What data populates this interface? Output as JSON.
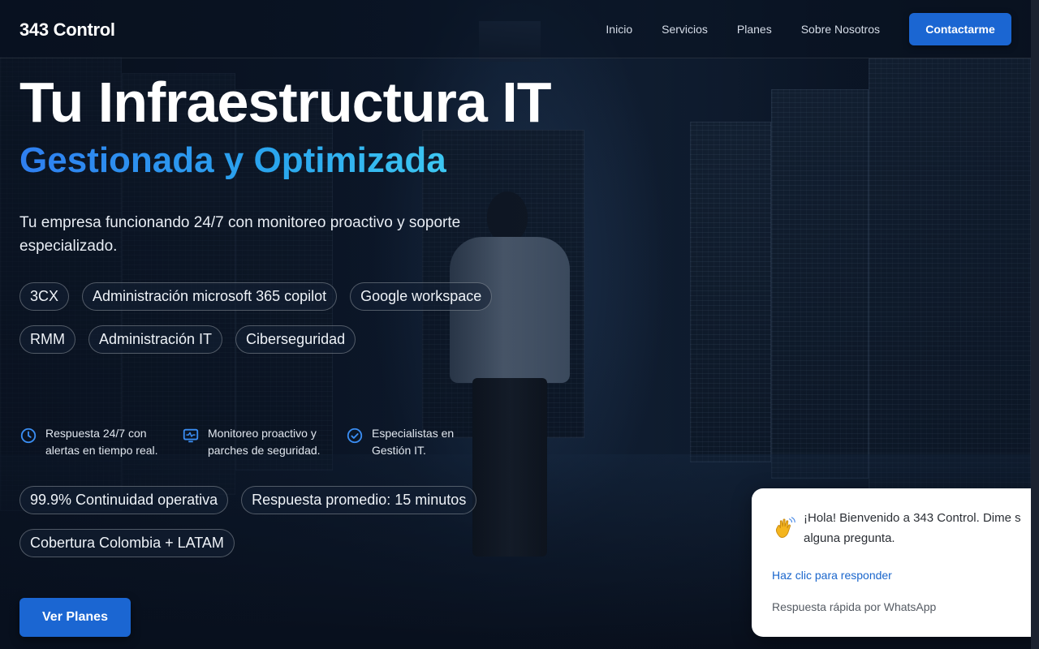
{
  "header": {
    "logo": "343 Control",
    "nav": [
      "Inicio",
      "Servicios",
      "Planes",
      "Sobre Nosotros"
    ],
    "cta_label": "Contactarme"
  },
  "hero": {
    "title": "Tu Infraestructura IT",
    "subtitle": "Gestionada y Optimizada",
    "description": "Tu empresa funcionando 24/7 con monitoreo proactivo y soporte especializado.",
    "services": [
      "3CX",
      "Administración microsoft 365 copilot",
      "Google workspace",
      "RMM",
      "Administración IT",
      "Ciberseguridad"
    ],
    "features": [
      {
        "icon": "clock-icon",
        "text": "Respuesta 24/7 con alertas en tiempo real."
      },
      {
        "icon": "monitor-icon",
        "text": "Monitoreo proactivo y parches de seguridad."
      },
      {
        "icon": "check-circle-icon",
        "text": "Especialistas en Gestión IT."
      }
    ],
    "stats": [
      "99.9% Continuidad operativa",
      "Respuesta promedio: 15 minutos",
      "Cobertura Colombia + LATAM"
    ],
    "plans_label": "Ver Planes"
  },
  "chat": {
    "icon": "waving-hand-icon",
    "message_line1": "¡Hola! Bienvenido a 343 Control. Dime s",
    "message_line2": "alguna pregunta.",
    "link": "Haz clic para responder",
    "note": "Respuesta rápida por WhatsApp"
  },
  "colors": {
    "accent": "#1b66d2",
    "subtitle_gradient_start": "#2f7ff0",
    "subtitle_gradient_end": "#3dc7f2",
    "link": "#1a66cc"
  }
}
